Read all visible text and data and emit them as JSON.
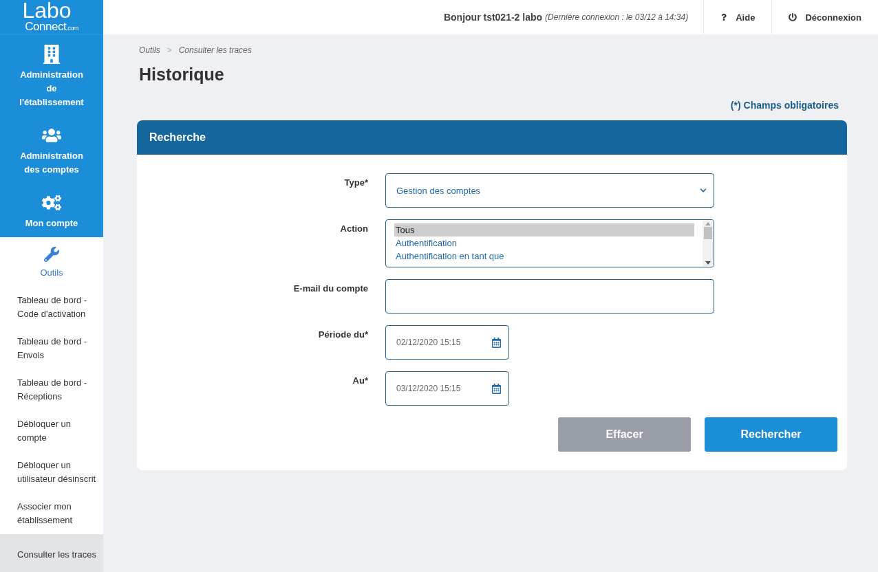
{
  "logo": {
    "line_1": "Labo",
    "line_2": "Connect",
    "suffix": ".com"
  },
  "nav": [
    {
      "label": "Administration de l'établissement",
      "selected": false
    },
    {
      "label": "Administration des comptes",
      "selected": false
    },
    {
      "label": "Mon compte",
      "selected": false
    },
    {
      "label": "Outils",
      "selected": true
    }
  ],
  "submenu": [
    {
      "label": "Tableau de bord - Code d'activation",
      "selected": false
    },
    {
      "label": "Tableau de bord - Envois",
      "selected": false
    },
    {
      "label": "Tableau de bord - Réceptions",
      "selected": false
    },
    {
      "label": "Débloquer un compte",
      "selected": false
    },
    {
      "label": "Débloquer un utilisateur désinscrit",
      "selected": false
    },
    {
      "label": "Associer mon établissement",
      "selected": false
    },
    {
      "label": "Consulter les traces",
      "selected": true
    }
  ],
  "header": {
    "greeting": "Bonjour tst021-2 labo",
    "last_login": "(Dernière connexion : le 03/12 à 14:34)",
    "help": "Aide",
    "logout": "Déconnexion"
  },
  "breadcrumb": [
    "Outils",
    "Consulter les traces"
  ],
  "breadcrumb_separator": ">",
  "title": "Historique",
  "required_note": "(*) Champs obligatoires",
  "panel": {
    "title": "Recherche",
    "fields": [
      {
        "kind": "select",
        "label": "Type*",
        "value": "Gestion des comptes"
      },
      {
        "kind": "listbox",
        "label": "Action",
        "options": [
          {
            "label": "Tous",
            "selected": true
          },
          {
            "label": "Authentification",
            "selected": false
          },
          {
            "label": "Authentification en tant que",
            "selected": false
          }
        ]
      },
      {
        "kind": "text",
        "label": "E-mail du compte"
      },
      {
        "kind": "date",
        "label": "Période du*",
        "value": "02/12/2020 15:15"
      },
      {
        "kind": "date",
        "label": "Au*",
        "value": "03/12/2020 15:15"
      }
    ],
    "buttons": [
      {
        "label": "Effacer",
        "kind": "secondary"
      },
      {
        "label": "Rechercher",
        "kind": "primary"
      }
    ]
  }
}
